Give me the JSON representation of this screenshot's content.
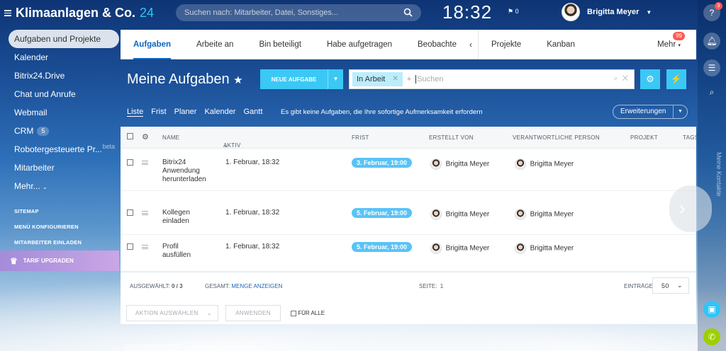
{
  "header": {
    "app_title": "Klimaanlagen & Co.",
    "app_num": "24",
    "search_placeholder": "Suchen nach: Mitarbeiter, Datei, Sonstiges...",
    "clock": "18:32",
    "flag_count": "0",
    "user_name": "Brigitta Meyer"
  },
  "nav": {
    "items": [
      {
        "label": "Aufgaben und Projekte"
      },
      {
        "label": "Kalender"
      },
      {
        "label": "Bitrix24.Drive"
      },
      {
        "label": "Chat und Anrufe"
      },
      {
        "label": "Webmail"
      },
      {
        "label": "CRM",
        "badge": "5"
      },
      {
        "label": "Robotergesteuerte Pr...",
        "tag": "beta"
      },
      {
        "label": "Mitarbeiter"
      },
      {
        "label": "Mehr..."
      }
    ],
    "sitemap": "SITEMAP",
    "menu_config": "MENÜ KONFIGURIEREN",
    "invite": "MITARBEITER EINLADEN",
    "upgrade": "TARIF UPGRADEN"
  },
  "right_panel": {
    "help_badge": "3",
    "contacts_label": "Meine Kontakte"
  },
  "tabs": {
    "items": [
      "Aufgaben",
      "Arbeite an",
      "Bin beteiligt",
      "Habe aufgetragen",
      "Beobachte"
    ],
    "projects": "Projekte",
    "kanban": "Kanban",
    "more": "Mehr",
    "more_count": "99"
  },
  "page": {
    "title": "Meine Aufgaben",
    "new_task": "NEUE AUFGABE",
    "filter_chip": "In Arbeit",
    "filter_placeholder": "Suchen",
    "subnav": [
      "Liste",
      "Frist",
      "Planer",
      "Kalender",
      "Gantt"
    ],
    "notice": "Es gibt keine Aufgaben, die Ihre sofortige Aufmerksamkeit erfordern",
    "extensions": "Erweiterungen"
  },
  "table": {
    "columns": {
      "name": "NAME",
      "active": "AKTIV",
      "deadline": "FRIST",
      "created_by": "ERSTELLT VON",
      "responsible": "VERANTWORTLICHE PERSON",
      "project": "PROJEKT",
      "tags": "TAGS"
    },
    "rows": [
      {
        "name": "Bitrix24 Anwendung herunterladen",
        "active": "1. Februar, 18:32",
        "deadline": "3. Februar, 19:00",
        "created_by": "Brigitta Meyer",
        "responsible": "Brigitta Meyer"
      },
      {
        "name": "Kollegen einladen",
        "active": "1. Februar, 18:32",
        "deadline": "5. Februar, 19:00",
        "created_by": "Brigitta Meyer",
        "responsible": "Brigitta Meyer"
      },
      {
        "name": "Profil ausfüllen",
        "active": "1. Februar, 18:32",
        "deadline": "5. Februar, 19:00",
        "created_by": "Brigitta Meyer",
        "responsible": "Brigitta Meyer"
      }
    ],
    "selected_label": "AUSGEWÄHLT:",
    "selected_value": "0 / 3",
    "total_label": "GESAMT:",
    "total_link": "MENGE ANZEIGEN",
    "page_label": "SEITE:",
    "page_value": "1",
    "entries_label": "EINTRÄGE",
    "entries_value": "50",
    "action_select": "AKTION AUSWÄHLEN",
    "apply": "ANWENDEN",
    "for_all": "FÜR ALLE"
  }
}
